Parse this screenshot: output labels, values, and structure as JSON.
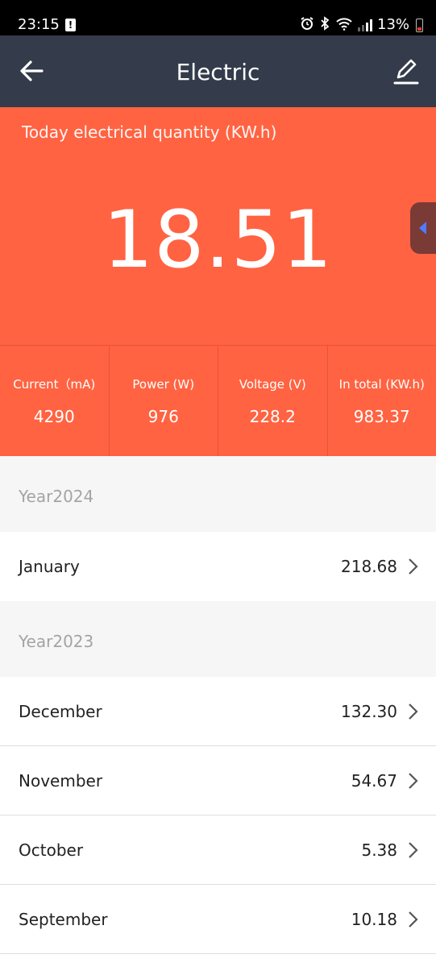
{
  "status_bar": {
    "time": "23:15",
    "alert_glyph": "!",
    "alarm_icon": "alarm-icon",
    "bluetooth_icon": "bluetooth-icon",
    "wifi_icon": "wifi-icon",
    "battery_percent": "13%"
  },
  "app_bar": {
    "title": "Electric",
    "back_icon": "back-arrow-icon",
    "edit_icon": "edit-pencil-icon"
  },
  "hero": {
    "label": "Today electrical quantity (KW.h)",
    "value": "18.51"
  },
  "stats": [
    {
      "label": "Current（mA)",
      "value": "4290"
    },
    {
      "label": "Power (W)",
      "value": "976"
    },
    {
      "label": "Voltage (V)",
      "value": "228.2"
    },
    {
      "label": "In total (KW.h)",
      "value": "983.37"
    }
  ],
  "groups": [
    {
      "year": "Year2024",
      "months": [
        {
          "name": "January",
          "value": "218.68"
        }
      ]
    },
    {
      "year": "Year2023",
      "months": [
        {
          "name": "December",
          "value": "132.30"
        },
        {
          "name": "November",
          "value": "54.67"
        },
        {
          "name": "October",
          "value": "5.38"
        },
        {
          "name": "September",
          "value": "10.18"
        }
      ]
    }
  ],
  "colors": {
    "header": "#343b4b",
    "accent": "#ff6342",
    "section_bg": "#f6f6f6",
    "side_tab_arrow": "#4d7cff"
  }
}
